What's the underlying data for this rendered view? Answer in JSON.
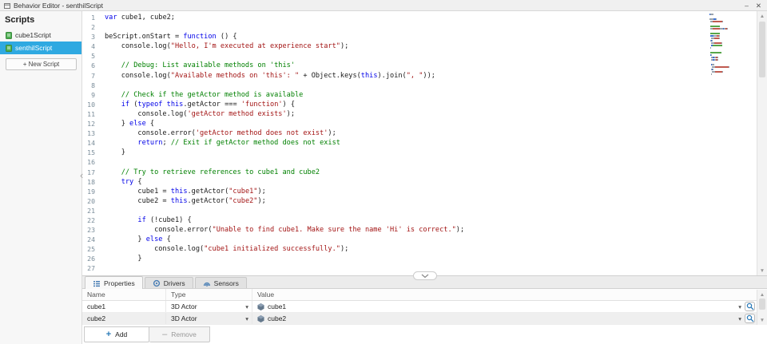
{
  "titlebar": {
    "title": "Behavior Editor - senthilScript",
    "minimize_glyph": "–",
    "close_glyph": "✕"
  },
  "icons": {
    "dropdown_glyph": "▾",
    "scroll_up_glyph": "▲",
    "scroll_down_glyph": "▼",
    "collapse_left_glyph": "‹"
  },
  "sidebar": {
    "header": "Scripts",
    "scripts": [
      {
        "label": "cube1Script",
        "selected": false
      },
      {
        "label": "senthilScript",
        "selected": true
      }
    ],
    "new_script_label": "+ New Script"
  },
  "editor": {
    "lines": [
      {
        "n": 1,
        "t": [
          [
            "k",
            "var"
          ],
          [
            "p",
            " cube1, cube2;"
          ]
        ]
      },
      {
        "n": 2,
        "t": []
      },
      {
        "n": 3,
        "t": [
          [
            "p",
            "beScript.onStart = "
          ],
          [
            "k",
            "function"
          ],
          [
            "p",
            " () {"
          ]
        ]
      },
      {
        "n": 4,
        "t": [
          [
            "p",
            "    console.log("
          ],
          [
            "s",
            "\"Hello, I'm executed at experience start\""
          ],
          [
            "p",
            ");"
          ]
        ]
      },
      {
        "n": 5,
        "t": []
      },
      {
        "n": 6,
        "t": [
          [
            "c",
            "    // Debug: List available methods on 'this'"
          ]
        ]
      },
      {
        "n": 7,
        "t": [
          [
            "p",
            "    console.log("
          ],
          [
            "s",
            "\"Available methods on 'this': \""
          ],
          [
            "p",
            " + Object.keys("
          ],
          [
            "k",
            "this"
          ],
          [
            "p",
            ").join("
          ],
          [
            "s",
            "\", \""
          ],
          [
            "p",
            "));"
          ]
        ]
      },
      {
        "n": 8,
        "t": []
      },
      {
        "n": 9,
        "t": [
          [
            "c",
            "    // Check if the getActor method is available"
          ]
        ]
      },
      {
        "n": 10,
        "t": [
          [
            "p",
            "    "
          ],
          [
            "k",
            "if"
          ],
          [
            "p",
            " ("
          ],
          [
            "k",
            "typeof"
          ],
          [
            "p",
            " "
          ],
          [
            "k",
            "this"
          ],
          [
            "p",
            ".getActor === "
          ],
          [
            "s",
            "'function'"
          ],
          [
            "p",
            ") {"
          ]
        ]
      },
      {
        "n": 11,
        "t": [
          [
            "p",
            "        console.log("
          ],
          [
            "s",
            "'getActor method exists'"
          ],
          [
            "p",
            ");"
          ]
        ]
      },
      {
        "n": 12,
        "t": [
          [
            "p",
            "    } "
          ],
          [
            "k",
            "else"
          ],
          [
            "p",
            " {"
          ]
        ]
      },
      {
        "n": 13,
        "t": [
          [
            "p",
            "        console.error("
          ],
          [
            "s",
            "'getActor method does not exist'"
          ],
          [
            "p",
            ");"
          ]
        ]
      },
      {
        "n": 14,
        "t": [
          [
            "p",
            "        "
          ],
          [
            "k",
            "return"
          ],
          [
            "p",
            "; "
          ],
          [
            "c",
            "// Exit if getActor method does not exist"
          ]
        ]
      },
      {
        "n": 15,
        "t": [
          [
            "p",
            "    }"
          ]
        ]
      },
      {
        "n": 16,
        "t": []
      },
      {
        "n": 17,
        "t": [
          [
            "c",
            "    // Try to retrieve references to cube1 and cube2"
          ]
        ]
      },
      {
        "n": 18,
        "t": [
          [
            "p",
            "    "
          ],
          [
            "k",
            "try"
          ],
          [
            "p",
            " {"
          ]
        ]
      },
      {
        "n": 19,
        "t": [
          [
            "p",
            "        cube1 = "
          ],
          [
            "k",
            "this"
          ],
          [
            "p",
            ".getActor("
          ],
          [
            "s",
            "\"cube1\""
          ],
          [
            "p",
            ");"
          ]
        ]
      },
      {
        "n": 20,
        "t": [
          [
            "p",
            "        cube2 = "
          ],
          [
            "k",
            "this"
          ],
          [
            "p",
            ".getActor("
          ],
          [
            "s",
            "\"cube2\""
          ],
          [
            "p",
            ");"
          ]
        ]
      },
      {
        "n": 21,
        "t": []
      },
      {
        "n": 22,
        "t": [
          [
            "p",
            "        "
          ],
          [
            "k",
            "if"
          ],
          [
            "p",
            " (!cube1) {"
          ]
        ]
      },
      {
        "n": 23,
        "t": [
          [
            "p",
            "            console.error("
          ],
          [
            "s",
            "\"Unable to find cube1. Make sure the name 'Hi' is correct.\""
          ],
          [
            "p",
            ");"
          ]
        ]
      },
      {
        "n": 24,
        "t": [
          [
            "p",
            "        } "
          ],
          [
            "k",
            "else"
          ],
          [
            "p",
            " {"
          ]
        ]
      },
      {
        "n": 25,
        "t": [
          [
            "p",
            "            console.log("
          ],
          [
            "s",
            "\"cube1 initialized successfully.\""
          ],
          [
            "p",
            ");"
          ]
        ]
      },
      {
        "n": 26,
        "t": [
          [
            "p",
            "        }"
          ]
        ]
      },
      {
        "n": 27,
        "t": []
      }
    ]
  },
  "panel": {
    "tabs": [
      {
        "label": "Properties",
        "icon": "properties-icon",
        "selected": true
      },
      {
        "label": "Drivers",
        "icon": "drivers-icon",
        "selected": false
      },
      {
        "label": "Sensors",
        "icon": "sensors-icon",
        "selected": false
      }
    ],
    "columns": [
      "Name",
      "Type",
      "Value"
    ],
    "rows": [
      {
        "name": "cube1",
        "type": "3D Actor",
        "value": "cube1"
      },
      {
        "name": "cube2",
        "type": "3D Actor",
        "value": "cube2"
      }
    ],
    "add_glyph": "+",
    "add_label": "Add",
    "remove_glyph": "–",
    "remove_label": "Remove"
  },
  "colors": {
    "accent": "#2fa9e1",
    "keyword": "#0000e8",
    "string": "#a31515",
    "comment": "#008000",
    "icon_blue": "#4a7fb5"
  }
}
